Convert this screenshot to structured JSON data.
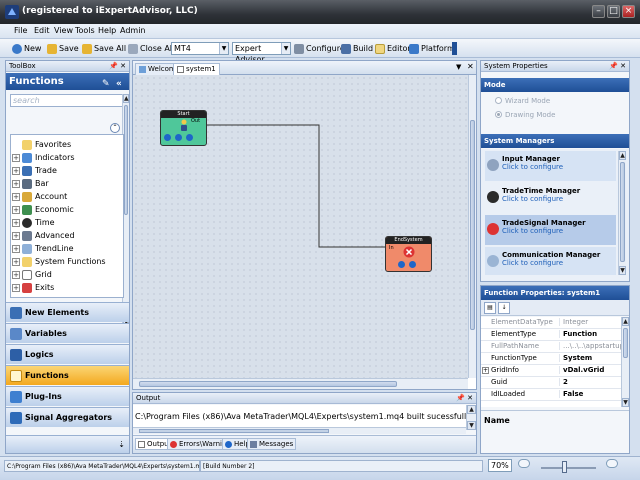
{
  "window": {
    "title": "(registered to iExpertAdvisor, LLC)"
  },
  "menu": [
    "File",
    "Edit",
    "View",
    "Tools",
    "Help",
    "Admin"
  ],
  "toolbar": {
    "new": "New",
    "save": "Save",
    "save_all": "Save All",
    "close_all": "Close All",
    "platform_combo": "MT4",
    "type_combo": "Expert Advisor",
    "configure": "Configure",
    "build": "Build",
    "editor": "Editor",
    "platform": "Platform"
  },
  "toolbox": {
    "title": "ToolBox",
    "header": "Functions",
    "search_placeholder": "search",
    "tree": [
      "Favorites",
      "Indicators",
      "Trade",
      "Bar",
      "Account",
      "Economic",
      "Time",
      "Advanced",
      "TrendLine",
      "System Functions",
      "Grid",
      "Exits"
    ],
    "categories": [
      "New Elements",
      "Variables",
      "Logics",
      "Functions",
      "Plug-Ins",
      "Signal Aggregators"
    ],
    "active_category": "Functions"
  },
  "document": {
    "tabs": [
      "Welcome",
      "system1"
    ],
    "active_tab": "system1",
    "nodes": {
      "start": {
        "title": "Start",
        "port_out": "Out"
      },
      "end": {
        "title": "EndSystem",
        "port_in": "In"
      }
    }
  },
  "output": {
    "title": "Output",
    "text": "C:\\Program Files (x86)\\Ava MetaTrader\\MQL4\\Experts\\system1.mq4 built sucessfully!",
    "tabs": [
      "Output",
      "Errors\\Warnings",
      "Help",
      "Messages"
    ]
  },
  "system_properties": {
    "title": "System Properties",
    "mode_header": "Mode",
    "modes": [
      "Wizard Mode",
      "Drawing Mode"
    ],
    "managers_header": "System Managers",
    "managers": [
      {
        "name": "Input Manager",
        "sub": "Click to configure"
      },
      {
        "name": "TradeTime Manager",
        "sub": "Click to configure"
      },
      {
        "name": "TradeSignal Manager",
        "sub": "Click to configure"
      },
      {
        "name": "Communication Manager",
        "sub": "Click to configure"
      }
    ]
  },
  "function_properties": {
    "title": "Function Properties: system1",
    "rows": [
      {
        "key": "ElementDataType",
        "value": "Integer"
      },
      {
        "key": "ElementType",
        "value": "Function"
      },
      {
        "key": "FullPathName",
        "value": "...\\..\\..\\appstartup\\eleme"
      },
      {
        "key": "FunctionType",
        "value": "System"
      },
      {
        "key": "GridInfo",
        "value": "vDal.vGrid"
      },
      {
        "key": "Guid",
        "value": "2"
      },
      {
        "key": "IdILoaded",
        "value": "False"
      }
    ],
    "description_label": "Name"
  },
  "status": {
    "path": "C:\\Program Files (x86)\\Ava MetaTrader\\MQL4\\Experts\\system1.mq4 Success!",
    "build": "[Build Number 2]",
    "zoom": "70%"
  },
  "colors": {
    "accent_blue": "#1f4f96",
    "active_orange": "#f3a81f",
    "start_node": "#4fc79a",
    "end_node": "#f08a6a"
  }
}
